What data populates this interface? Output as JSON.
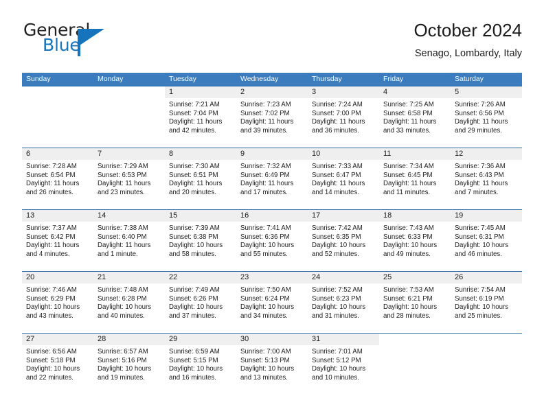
{
  "brand": {
    "word_general": "General",
    "word_blue": "Blue",
    "mark_color": "#1574bb"
  },
  "header": {
    "title": "October 2024",
    "subtitle": "Senago, Lombardy, Italy"
  },
  "colors": {
    "header_blue": "#3a7cbe",
    "row_divider_blue": "#2b6ca8",
    "day_band_gray": "#efefef",
    "brand_blue": "#1574bb",
    "text": "#1c1c1c"
  },
  "weekdays": [
    "Sunday",
    "Monday",
    "Tuesday",
    "Wednesday",
    "Thursday",
    "Friday",
    "Saturday"
  ],
  "weeks": [
    [
      {
        "day": "",
        "sunrise": "",
        "sunset": "",
        "daylight1": "",
        "daylight2": "",
        "blank": true
      },
      {
        "day": "",
        "sunrise": "",
        "sunset": "",
        "daylight1": "",
        "daylight2": "",
        "blank": true
      },
      {
        "day": "1",
        "sunrise": "Sunrise: 7:21 AM",
        "sunset": "Sunset: 7:04 PM",
        "daylight1": "Daylight: 11 hours",
        "daylight2": "and 42 minutes."
      },
      {
        "day": "2",
        "sunrise": "Sunrise: 7:23 AM",
        "sunset": "Sunset: 7:02 PM",
        "daylight1": "Daylight: 11 hours",
        "daylight2": "and 39 minutes."
      },
      {
        "day": "3",
        "sunrise": "Sunrise: 7:24 AM",
        "sunset": "Sunset: 7:00 PM",
        "daylight1": "Daylight: 11 hours",
        "daylight2": "and 36 minutes."
      },
      {
        "day": "4",
        "sunrise": "Sunrise: 7:25 AM",
        "sunset": "Sunset: 6:58 PM",
        "daylight1": "Daylight: 11 hours",
        "daylight2": "and 33 minutes."
      },
      {
        "day": "5",
        "sunrise": "Sunrise: 7:26 AM",
        "sunset": "Sunset: 6:56 PM",
        "daylight1": "Daylight: 11 hours",
        "daylight2": "and 29 minutes."
      }
    ],
    [
      {
        "day": "6",
        "sunrise": "Sunrise: 7:28 AM",
        "sunset": "Sunset: 6:54 PM",
        "daylight1": "Daylight: 11 hours",
        "daylight2": "and 26 minutes."
      },
      {
        "day": "7",
        "sunrise": "Sunrise: 7:29 AM",
        "sunset": "Sunset: 6:53 PM",
        "daylight1": "Daylight: 11 hours",
        "daylight2": "and 23 minutes."
      },
      {
        "day": "8",
        "sunrise": "Sunrise: 7:30 AM",
        "sunset": "Sunset: 6:51 PM",
        "daylight1": "Daylight: 11 hours",
        "daylight2": "and 20 minutes."
      },
      {
        "day": "9",
        "sunrise": "Sunrise: 7:32 AM",
        "sunset": "Sunset: 6:49 PM",
        "daylight1": "Daylight: 11 hours",
        "daylight2": "and 17 minutes."
      },
      {
        "day": "10",
        "sunrise": "Sunrise: 7:33 AM",
        "sunset": "Sunset: 6:47 PM",
        "daylight1": "Daylight: 11 hours",
        "daylight2": "and 14 minutes."
      },
      {
        "day": "11",
        "sunrise": "Sunrise: 7:34 AM",
        "sunset": "Sunset: 6:45 PM",
        "daylight1": "Daylight: 11 hours",
        "daylight2": "and 11 minutes."
      },
      {
        "day": "12",
        "sunrise": "Sunrise: 7:36 AM",
        "sunset": "Sunset: 6:43 PM",
        "daylight1": "Daylight: 11 hours",
        "daylight2": "and 7 minutes."
      }
    ],
    [
      {
        "day": "13",
        "sunrise": "Sunrise: 7:37 AM",
        "sunset": "Sunset: 6:42 PM",
        "daylight1": "Daylight: 11 hours",
        "daylight2": "and 4 minutes."
      },
      {
        "day": "14",
        "sunrise": "Sunrise: 7:38 AM",
        "sunset": "Sunset: 6:40 PM",
        "daylight1": "Daylight: 11 hours",
        "daylight2": "and 1 minute."
      },
      {
        "day": "15",
        "sunrise": "Sunrise: 7:39 AM",
        "sunset": "Sunset: 6:38 PM",
        "daylight1": "Daylight: 10 hours",
        "daylight2": "and 58 minutes."
      },
      {
        "day": "16",
        "sunrise": "Sunrise: 7:41 AM",
        "sunset": "Sunset: 6:36 PM",
        "daylight1": "Daylight: 10 hours",
        "daylight2": "and 55 minutes."
      },
      {
        "day": "17",
        "sunrise": "Sunrise: 7:42 AM",
        "sunset": "Sunset: 6:35 PM",
        "daylight1": "Daylight: 10 hours",
        "daylight2": "and 52 minutes."
      },
      {
        "day": "18",
        "sunrise": "Sunrise: 7:43 AM",
        "sunset": "Sunset: 6:33 PM",
        "daylight1": "Daylight: 10 hours",
        "daylight2": "and 49 minutes."
      },
      {
        "day": "19",
        "sunrise": "Sunrise: 7:45 AM",
        "sunset": "Sunset: 6:31 PM",
        "daylight1": "Daylight: 10 hours",
        "daylight2": "and 46 minutes."
      }
    ],
    [
      {
        "day": "20",
        "sunrise": "Sunrise: 7:46 AM",
        "sunset": "Sunset: 6:29 PM",
        "daylight1": "Daylight: 10 hours",
        "daylight2": "and 43 minutes."
      },
      {
        "day": "21",
        "sunrise": "Sunrise: 7:48 AM",
        "sunset": "Sunset: 6:28 PM",
        "daylight1": "Daylight: 10 hours",
        "daylight2": "and 40 minutes."
      },
      {
        "day": "22",
        "sunrise": "Sunrise: 7:49 AM",
        "sunset": "Sunset: 6:26 PM",
        "daylight1": "Daylight: 10 hours",
        "daylight2": "and 37 minutes."
      },
      {
        "day": "23",
        "sunrise": "Sunrise: 7:50 AM",
        "sunset": "Sunset: 6:24 PM",
        "daylight1": "Daylight: 10 hours",
        "daylight2": "and 34 minutes."
      },
      {
        "day": "24",
        "sunrise": "Sunrise: 7:52 AM",
        "sunset": "Sunset: 6:23 PM",
        "daylight1": "Daylight: 10 hours",
        "daylight2": "and 31 minutes."
      },
      {
        "day": "25",
        "sunrise": "Sunrise: 7:53 AM",
        "sunset": "Sunset: 6:21 PM",
        "daylight1": "Daylight: 10 hours",
        "daylight2": "and 28 minutes."
      },
      {
        "day": "26",
        "sunrise": "Sunrise: 7:54 AM",
        "sunset": "Sunset: 6:19 PM",
        "daylight1": "Daylight: 10 hours",
        "daylight2": "and 25 minutes."
      }
    ],
    [
      {
        "day": "27",
        "sunrise": "Sunrise: 6:56 AM",
        "sunset": "Sunset: 5:18 PM",
        "daylight1": "Daylight: 10 hours",
        "daylight2": "and 22 minutes."
      },
      {
        "day": "28",
        "sunrise": "Sunrise: 6:57 AM",
        "sunset": "Sunset: 5:16 PM",
        "daylight1": "Daylight: 10 hours",
        "daylight2": "and 19 minutes."
      },
      {
        "day": "29",
        "sunrise": "Sunrise: 6:59 AM",
        "sunset": "Sunset: 5:15 PM",
        "daylight1": "Daylight: 10 hours",
        "daylight2": "and 16 minutes."
      },
      {
        "day": "30",
        "sunrise": "Sunrise: 7:00 AM",
        "sunset": "Sunset: 5:13 PM",
        "daylight1": "Daylight: 10 hours",
        "daylight2": "and 13 minutes."
      },
      {
        "day": "31",
        "sunrise": "Sunrise: 7:01 AM",
        "sunset": "Sunset: 5:12 PM",
        "daylight1": "Daylight: 10 hours",
        "daylight2": "and 10 minutes."
      },
      {
        "day": "",
        "sunrise": "",
        "sunset": "",
        "daylight1": "",
        "daylight2": "",
        "blank": true
      },
      {
        "day": "",
        "sunrise": "",
        "sunset": "",
        "daylight1": "",
        "daylight2": "",
        "blank": true
      }
    ]
  ]
}
